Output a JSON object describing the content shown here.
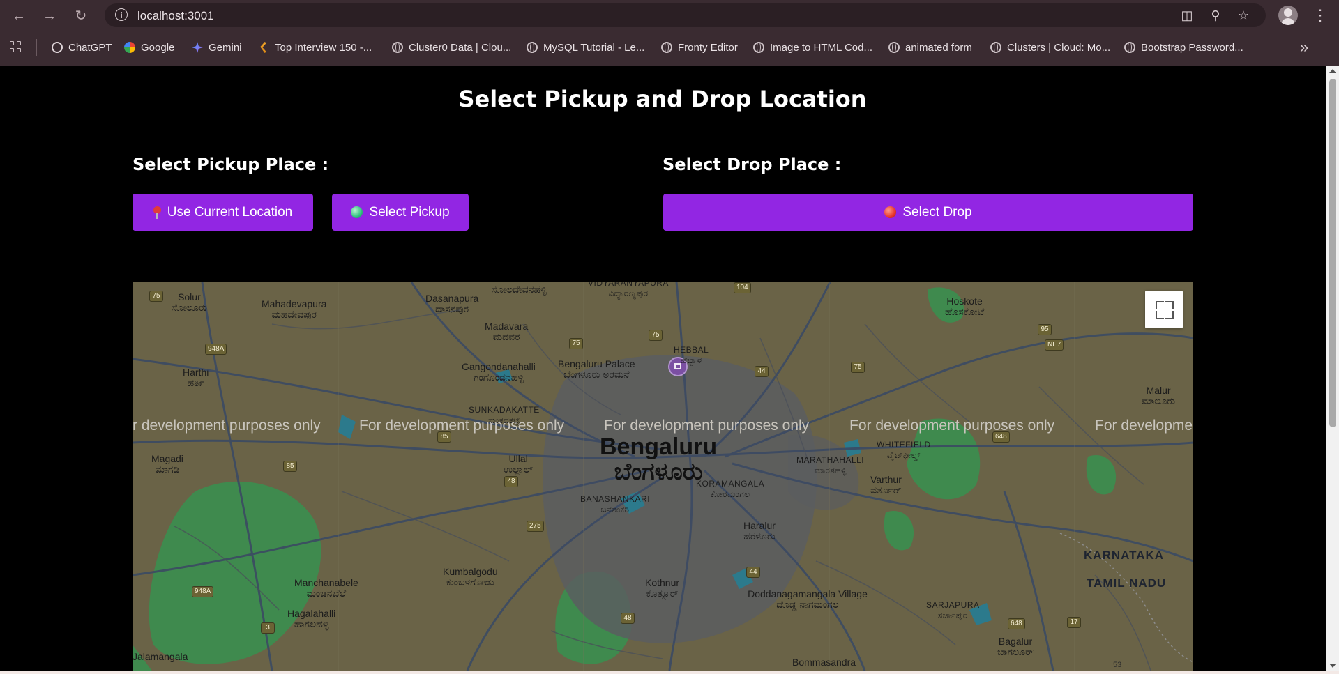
{
  "browser": {
    "url": "localhost:3001",
    "bookmarks": [
      {
        "label": "ChatGPT",
        "icon": "chatgpt-icon"
      },
      {
        "label": "Google",
        "icon": "google-icon"
      },
      {
        "label": "Gemini",
        "icon": "gemini-icon"
      },
      {
        "label": "Top Interview 150 -...",
        "icon": "leetcode-icon"
      },
      {
        "label": "Cluster0 Data | Clou...",
        "icon": "globe-icon"
      },
      {
        "label": "MySQL Tutorial - Le...",
        "icon": "globe-icon"
      },
      {
        "label": "Fronty Editor",
        "icon": "globe-icon"
      },
      {
        "label": "Image to HTML Cod...",
        "icon": "globe-icon"
      },
      {
        "label": "animated form",
        "icon": "globe-icon"
      },
      {
        "label": "Clusters | Cloud: Mo...",
        "icon": "globe-icon"
      },
      {
        "label": "Bootstrap Password...",
        "icon": "globe-icon"
      }
    ]
  },
  "page": {
    "title": "Select Pickup and Drop Location",
    "pickup_label": "Select Pickup Place :",
    "drop_label": "Select Drop Place :",
    "use_current_location": "Use Current Location",
    "select_pickup": "Select Pickup",
    "select_drop": "Select Drop",
    "accent_color": "#9226e3"
  },
  "map": {
    "dev_watermark": [
      "r development purposes only",
      "For development purposes only",
      "For development purposes only",
      "For development purposes only",
      "For developme"
    ],
    "city": {
      "en": "Bengaluru",
      "kn": "ಬೆಂಗಳೂರು"
    },
    "landmark": {
      "en": "Bengaluru Palace",
      "kn": "ಬೆಂಗಳೂರು ಅರಮನೆ"
    },
    "places": [
      {
        "en": "Solur",
        "kn": "ಸೋಲೂರು"
      },
      {
        "en": "Mahadevapura",
        "kn": "ಮಹದೇವಪುರ"
      },
      {
        "en": "Dasanapura",
        "kn": "ದಾಸನಪುರ"
      },
      {
        "en": "",
        "kn": "ಸೋಲದೇವನಹಳ್ಳಿ"
      },
      {
        "en": "VIDYARANYAPURA",
        "kn": "ವಿದ್ಯಾರಣ್ಯಪುರ"
      },
      {
        "en": "Hoskote",
        "kn": "ಹೊಸಕೋಟೆ"
      },
      {
        "en": "Madavara",
        "kn": "ಮದವರ"
      },
      {
        "en": "HEBBAL",
        "kn": "ಹೆಬ್ಬಾಳ"
      },
      {
        "en": "Harthi",
        "kn": "ಹರ್ತಿ"
      },
      {
        "en": "Gangondanahalli",
        "kn": "ಗಂಗೊಂಡನಹಳ್ಳಿ"
      },
      {
        "en": "Malur",
        "kn": "ಮಾಲೂರು"
      },
      {
        "en": "SUNKADAKATTE",
        "kn": "ಸುಂಕದಕಟ್ಟೆ"
      },
      {
        "en": "WHITEFIELD",
        "kn": "ವೈಟ್‌ಫೀಲ್ಡ್"
      },
      {
        "en": "Magadi",
        "kn": "ಮಾಗಡಿ"
      },
      {
        "en": "Ullal",
        "kn": "ಉಲ್ಲಾಲ್"
      },
      {
        "en": "MARATHAHALLI",
        "kn": "ಮಾರತಹಳ್ಳಿ"
      },
      {
        "en": "Varthur",
        "kn": "ವರ್ತೂರ್"
      },
      {
        "en": "KORAMANGALA",
        "kn": "ಕೋರಮಂಗಲ"
      },
      {
        "en": "BANASHANKARI",
        "kn": "ಬನಶಂಕರಿ"
      },
      {
        "en": "Haralur",
        "kn": "ಹರಳೂರು"
      },
      {
        "en": "Kumbalgodu",
        "kn": "ಕುಂಬಳಗೋಡು"
      },
      {
        "en": "Manchanabele",
        "kn": "ಮಂಚನಬೆಲೆ"
      },
      {
        "en": "Kothnur",
        "kn": "ಕೊತ್ನೂರ್"
      },
      {
        "en": "Doddanagamangala Village",
        "kn": "ದೊಡ್ಡ ನಾಗಮಂಗಲ"
      },
      {
        "en": "Hagalahalli",
        "kn": "ಹಾಗಲಹಳ್ಳಿ"
      },
      {
        "en": "SARJAPURA",
        "kn": "ಸರ್ಜಾಪುರ"
      },
      {
        "en": "Bagalur",
        "kn": "ಬಾಗಲೂರ್"
      },
      {
        "en": "Jalamangala",
        "kn": ""
      },
      {
        "en": "Bommasandra",
        "kn": ""
      }
    ],
    "states": [
      "KARNATAKA",
      "TAMIL NADU"
    ],
    "road_shields": [
      "75",
      "104",
      "95",
      "948A",
      "75",
      "75",
      "44",
      "75",
      "NE7",
      "85",
      "648",
      "85",
      "48",
      "275",
      "948A",
      "44",
      "3",
      "48",
      "648",
      "17",
      "53"
    ],
    "attribution": "53"
  }
}
